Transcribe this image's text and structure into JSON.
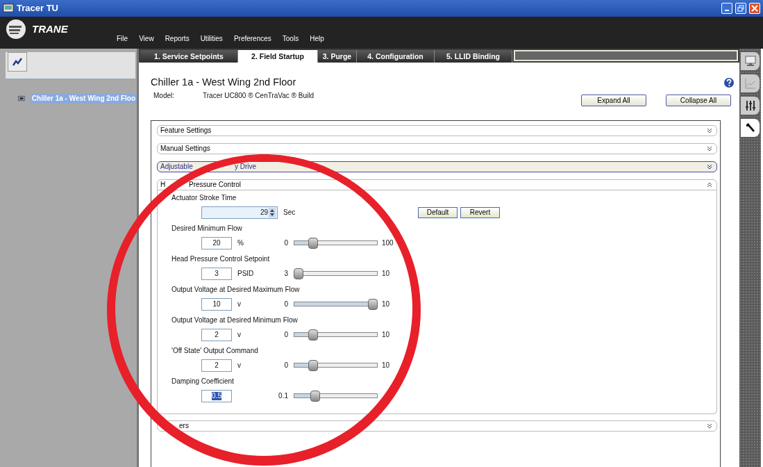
{
  "window": {
    "title": "Tracer TU"
  },
  "logo": "TRANE",
  "menu": [
    "File",
    "View",
    "Reports",
    "Utilities",
    "Preferences",
    "Tools",
    "Help"
  ],
  "sidebar": {
    "items": [
      {
        "label": "Chiller 1a - West Wing 2nd Floo",
        "selected": true
      }
    ]
  },
  "tabs": [
    {
      "label": "1. Service Setpoints",
      "selected": false
    },
    {
      "label": "2. Field Startup",
      "selected": true
    },
    {
      "label": "3. Purge",
      "selected": false
    },
    {
      "label": "4. Configuration",
      "selected": false
    },
    {
      "label": "5. LLID Binding",
      "selected": false
    }
  ],
  "side_tabs": [
    {
      "kind": "monitor",
      "selected": false
    },
    {
      "kind": "chart",
      "selected": false
    },
    {
      "kind": "sliders",
      "selected": false
    },
    {
      "kind": "wrench",
      "selected": true
    }
  ],
  "page": {
    "title": "Chiller 1a - West Wing 2nd Floor",
    "model_label": "Model:",
    "model_value": "Tracer UC800 ® CenTraVac ® Build",
    "buttons": [
      "Expand All",
      "Collapse All"
    ]
  },
  "sections": [
    {
      "title_parts": [
        "Feature Settings"
      ],
      "expanded": false,
      "highlighted": false
    },
    {
      "title_parts": [
        "Manual Settings"
      ],
      "expanded": false,
      "highlighted": false
    },
    {
      "title_parts": [
        "Adjustable",
        "y Drive"
      ],
      "expanded": false,
      "highlighted": true
    },
    {
      "title_parts": [
        "H",
        "Pressure Control"
      ],
      "expanded": true,
      "highlighted": false,
      "fields": [
        {
          "kind": "spin",
          "label": "Actuator Stroke Time",
          "value": "29",
          "unit": "Sec",
          "buttons": [
            "Default",
            "Revert"
          ]
        },
        {
          "kind": "slider",
          "label": "Desired Minimum Flow",
          "value": "20",
          "unit": "%",
          "min": "0",
          "max": "100",
          "level": 0.2
        },
        {
          "kind": "slider",
          "label": "Head Pressure Control Setpoint",
          "value": "3",
          "unit": "PSID",
          "min": "3",
          "max": "10",
          "level": 0
        },
        {
          "kind": "slider",
          "label": "Output Voltage at Desired Maximum Flow",
          "value": "10",
          "unit": "v",
          "min": "0",
          "max": "10",
          "level": 1
        },
        {
          "kind": "slider",
          "label": "Output Voltage at Desired Minimum Flow",
          "value": "2",
          "unit": "v",
          "min": "0",
          "max": "10",
          "level": 0.2
        },
        {
          "kind": "slider",
          "label": "'Off State' Output Command",
          "value": "2",
          "unit": "v",
          "min": "0",
          "max": "10",
          "level": 0.2
        },
        {
          "kind": "slider",
          "label": "Damping Coefficient",
          "value": "0.5",
          "min": "0.1",
          "level": 0.22,
          "value_selected": true
        }
      ]
    },
    {
      "title_parts": [
        "ers"
      ],
      "expanded": false,
      "highlighted": false
    }
  ]
}
